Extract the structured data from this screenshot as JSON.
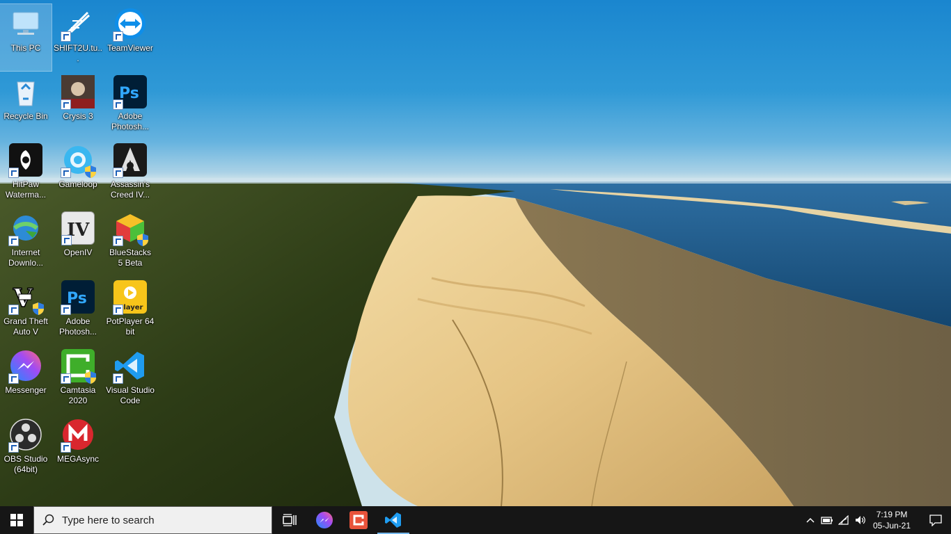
{
  "desktop": {
    "icons": [
      {
        "label": "This PC"
      },
      {
        "label": "SHIFT2U.tu..."
      },
      {
        "label": "TeamViewer"
      },
      {
        "label": "Recycle Bin"
      },
      {
        "label": "Crysis 3"
      },
      {
        "label": "Adobe Photosh..."
      },
      {
        "label": "HitPaw Waterma..."
      },
      {
        "label": "Gameloop"
      },
      {
        "label": "Assassin's Creed IV..."
      },
      {
        "label": "Internet Downlo..."
      },
      {
        "label": "OpenIV"
      },
      {
        "label": "BlueStacks 5 Beta"
      },
      {
        "label": "Grand Theft Auto V"
      },
      {
        "label": "Adobe Photosh..."
      },
      {
        "label": "PotPlayer 64 bit"
      },
      {
        "label": "Messenger"
      },
      {
        "label": "Camtasia 2020"
      },
      {
        "label": "Visual Studio Code"
      },
      {
        "label": "OBS Studio (64bit)"
      },
      {
        "label": "MEGAsync"
      }
    ]
  },
  "taskbar": {
    "search_placeholder": "Type here to search",
    "pinned": [
      "task-view",
      "messenger",
      "camtasia",
      "visual-studio-code"
    ],
    "active_app": "visual-studio-code",
    "clock": {
      "time": "7:19 PM",
      "date": "05-Jun-21"
    }
  },
  "colors": {
    "taskbar": "#161616",
    "accent": "#76b9ed",
    "sky": "#1a86cf",
    "sand": "#e8c98a",
    "forest": "#2e3d17",
    "sea": "#1f5b8a"
  }
}
